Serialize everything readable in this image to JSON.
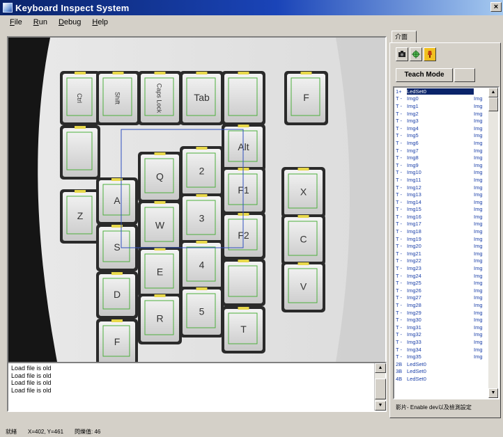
{
  "window": {
    "title": "Keyboard Inspect System",
    "close_glyph": "×"
  },
  "menu": [
    "File",
    "Run",
    "Debug",
    "Help"
  ],
  "image_view": {
    "keys": [
      {
        "label": "Ctrl"
      },
      {
        "label": "Shift"
      },
      {
        "label": "Caps Lock"
      },
      {
        "label": "Tab"
      },
      {
        "label": ""
      },
      {
        "label": "F"
      },
      {
        "label": ""
      },
      {
        "label": "Alt"
      },
      {
        "label": "Z"
      },
      {
        "label": "A"
      },
      {
        "label": "Q"
      },
      {
        "label": "2"
      },
      {
        "label": "F1"
      },
      {
        "label": "X"
      },
      {
        "label": "S"
      },
      {
        "label": "W"
      },
      {
        "label": "3"
      },
      {
        "label": "F2"
      },
      {
        "label": "C"
      },
      {
        "label": "D"
      },
      {
        "label": "E"
      },
      {
        "label": "4"
      },
      {
        "label": ""
      },
      {
        "label": "V"
      },
      {
        "label": "F"
      },
      {
        "label": "R"
      },
      {
        "label": "5"
      },
      {
        "label": "T"
      }
    ]
  },
  "log": [
    "Load file is old",
    "Load file is old",
    "Load file is old",
    "Load file is old"
  ],
  "right_panel": {
    "tab_label": "介面",
    "tool_icons": [
      "camera-icon",
      "crosshair-icon",
      "lamp-icon"
    ],
    "mode_button": "Teach Mode",
    "list": [
      {
        "col1": "1+",
        "col2": "LedSet0",
        "col3": "",
        "selected": true
      },
      {
        "col1": "T -",
        "col2": "Img0",
        "col3": "Img"
      },
      {
        "col1": "T -",
        "col2": "Img1",
        "col3": "Img"
      },
      {
        "col1": "T -",
        "col2": "Img2",
        "col3": "Img"
      },
      {
        "col1": "T -",
        "col2": "Img3",
        "col3": "Img"
      },
      {
        "col1": "T -",
        "col2": "Img4",
        "col3": "Img"
      },
      {
        "col1": "T -",
        "col2": "Img5",
        "col3": "Img"
      },
      {
        "col1": "T -",
        "col2": "Img6",
        "col3": "Img"
      },
      {
        "col1": "T -",
        "col2": "Img7",
        "col3": "Img"
      },
      {
        "col1": "T -",
        "col2": "Img8",
        "col3": "Img"
      },
      {
        "col1": "T -",
        "col2": "Img9",
        "col3": "Img"
      },
      {
        "col1": "T -",
        "col2": "Img10",
        "col3": "Img"
      },
      {
        "col1": "T -",
        "col2": "Img11",
        "col3": "Img"
      },
      {
        "col1": "T -",
        "col2": "Img12",
        "col3": "Img"
      },
      {
        "col1": "T -",
        "col2": "Img13",
        "col3": "Img"
      },
      {
        "col1": "T -",
        "col2": "Img14",
        "col3": "Img"
      },
      {
        "col1": "T -",
        "col2": "Img15",
        "col3": "Img"
      },
      {
        "col1": "T -",
        "col2": "Img16",
        "col3": "Img"
      },
      {
        "col1": "T -",
        "col2": "Img17",
        "col3": "Img"
      },
      {
        "col1": "T -",
        "col2": "Img18",
        "col3": "Img"
      },
      {
        "col1": "T -",
        "col2": "Img19",
        "col3": "Img"
      },
      {
        "col1": "T -",
        "col2": "Img20",
        "col3": "Img"
      },
      {
        "col1": "T -",
        "col2": "Img21",
        "col3": "Img"
      },
      {
        "col1": "T -",
        "col2": "Img22",
        "col3": "Img"
      },
      {
        "col1": "T -",
        "col2": "Img23",
        "col3": "Img"
      },
      {
        "col1": "T -",
        "col2": "Img24",
        "col3": "Img"
      },
      {
        "col1": "T -",
        "col2": "Img25",
        "col3": "Img"
      },
      {
        "col1": "T -",
        "col2": "Img26",
        "col3": "Img"
      },
      {
        "col1": "T -",
        "col2": "Img27",
        "col3": "Img"
      },
      {
        "col1": "T -",
        "col2": "Img28",
        "col3": "Img"
      },
      {
        "col1": "T -",
        "col2": "Img29",
        "col3": "Img"
      },
      {
        "col1": "T -",
        "col2": "Img30",
        "col3": "Img"
      },
      {
        "col1": "T -",
        "col2": "Img31",
        "col3": "Img"
      },
      {
        "col1": "T -",
        "col2": "Img32",
        "col3": "Img"
      },
      {
        "col1": "T -",
        "col2": "Img33",
        "col3": "Img"
      },
      {
        "col1": "T -",
        "col2": "Img34",
        "col3": "Img"
      },
      {
        "col1": "T -",
        "col2": "Img35",
        "col3": "Img"
      },
      {
        "col1": "2B",
        "col2": "LedSet0",
        "col3": ""
      },
      {
        "col1": "3B",
        "col2": "LedSet0",
        "col3": ""
      },
      {
        "col1": "4B",
        "col2": "LedSet0",
        "col3": ""
      }
    ],
    "status_text": "影片- Enable dev以及檢測設定"
  },
  "statusbar": [
    "就緒",
    "X=402, Y=461",
    "閃爍值: 46"
  ],
  "scrollbar_glyphs": {
    "up": "▲",
    "down": "▼"
  }
}
